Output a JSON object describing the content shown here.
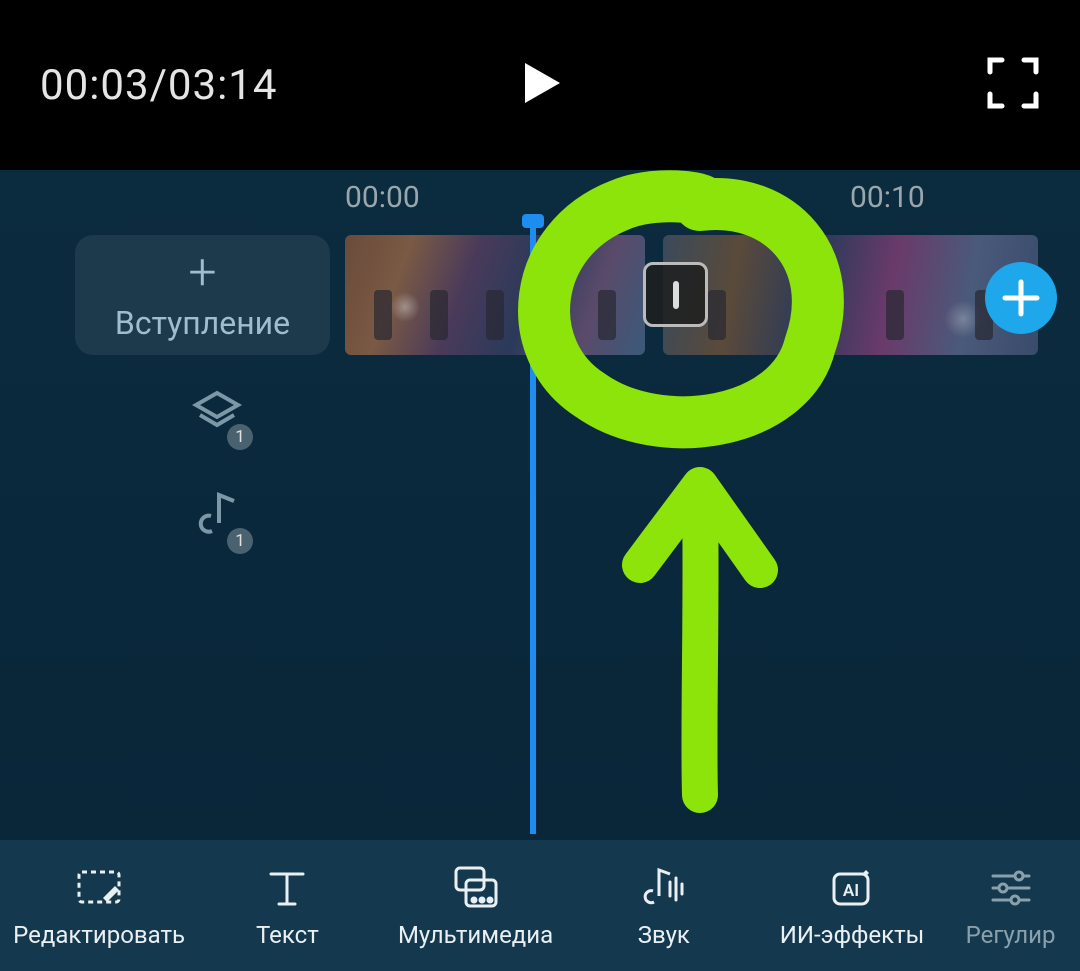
{
  "playback": {
    "current_time": "00:03",
    "total_time": "03:14",
    "display": "00:03/03:14"
  },
  "intro_button": {
    "label": "Вступление"
  },
  "ruler": {
    "t0": "00:00",
    "t1": "00:",
    "t2": "00:10"
  },
  "side_icons": {
    "layers_badge": "1",
    "music_badge": "1"
  },
  "toolbar": {
    "edit": "Редактировать",
    "text": "Текст",
    "multimedia": "Мультимедиа",
    "sound": "Звук",
    "ai_effects": "ИИ-эффекты",
    "adjust": "Регулир"
  },
  "colors": {
    "accent_blue": "#1fa7ec",
    "playhead": "#1f8df0",
    "annotation": "#8de40a"
  }
}
